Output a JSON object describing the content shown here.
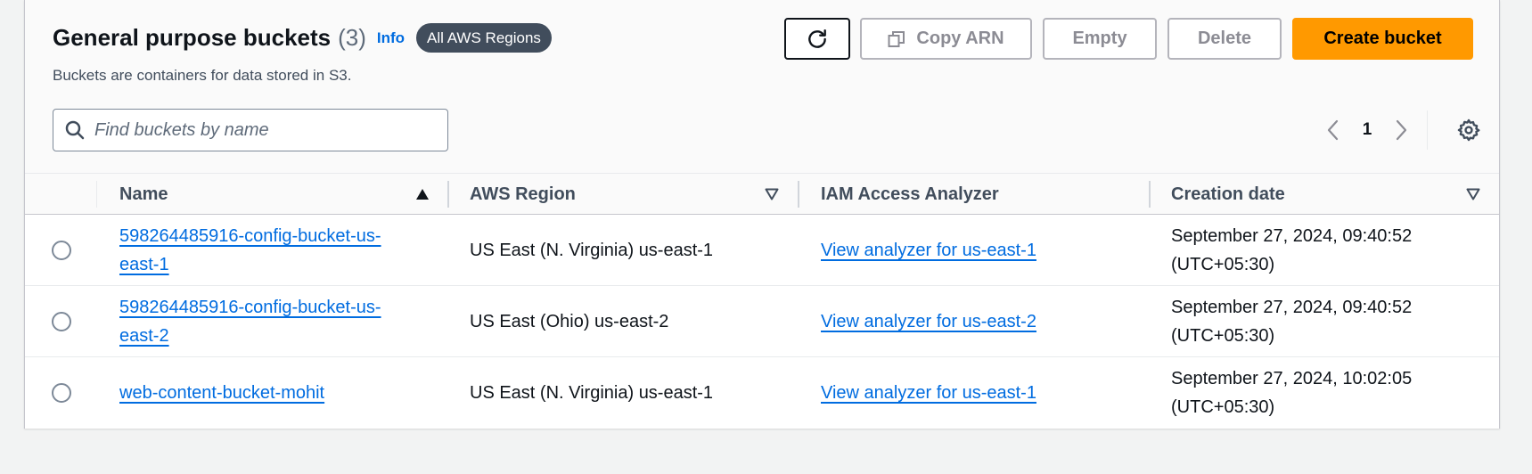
{
  "header": {
    "title": "General purpose buckets",
    "count": "(3)",
    "info_label": "Info",
    "region_badge": "All AWS Regions",
    "description": "Buckets are containers for data stored in S3."
  },
  "actions": {
    "copy_arn": "Copy ARN",
    "empty": "Empty",
    "delete": "Delete",
    "create_bucket": "Create bucket"
  },
  "search": {
    "placeholder": "Find buckets by name",
    "value": ""
  },
  "pagination": {
    "current_page": "1"
  },
  "table": {
    "columns": [
      {
        "label": "Name",
        "sort": "ascending"
      },
      {
        "label": "AWS Region",
        "sort": "sortable"
      },
      {
        "label": "IAM Access Analyzer",
        "sort": "none"
      },
      {
        "label": "Creation date",
        "sort": "sortable"
      }
    ],
    "rows": [
      {
        "name": "598264485916-config-bucket-us-east-1",
        "region": "US East (N. Virginia) us-east-1",
        "analyzer": "View analyzer for us-east-1",
        "created": "September 27, 2024, 09:40:52 (UTC+05:30)",
        "selected": false
      },
      {
        "name": "598264485916-config-bucket-us-east-2",
        "region": "US East (Ohio) us-east-2",
        "analyzer": "View analyzer for us-east-2",
        "created": "September 27, 2024, 09:40:52 (UTC+05:30)",
        "selected": false
      },
      {
        "name": "web-content-bucket-mohit",
        "region": "US East (N. Virginia) us-east-1",
        "analyzer": "View analyzer for us-east-1",
        "created": "September 27, 2024, 10:02:05 (UTC+05:30)",
        "selected": false
      }
    ]
  },
  "icons": {
    "refresh": "refresh-icon",
    "copy": "copy-icon",
    "search": "search-icon",
    "prev": "chevron-left-icon",
    "next": "chevron-right-icon",
    "settings": "gear-icon",
    "sort_asc": "sort-ascending-icon",
    "sort_desc": "sort-descending-icon"
  },
  "colors": {
    "primary": "#ff9900",
    "link": "#006ce0",
    "badge": "#414d5c"
  }
}
